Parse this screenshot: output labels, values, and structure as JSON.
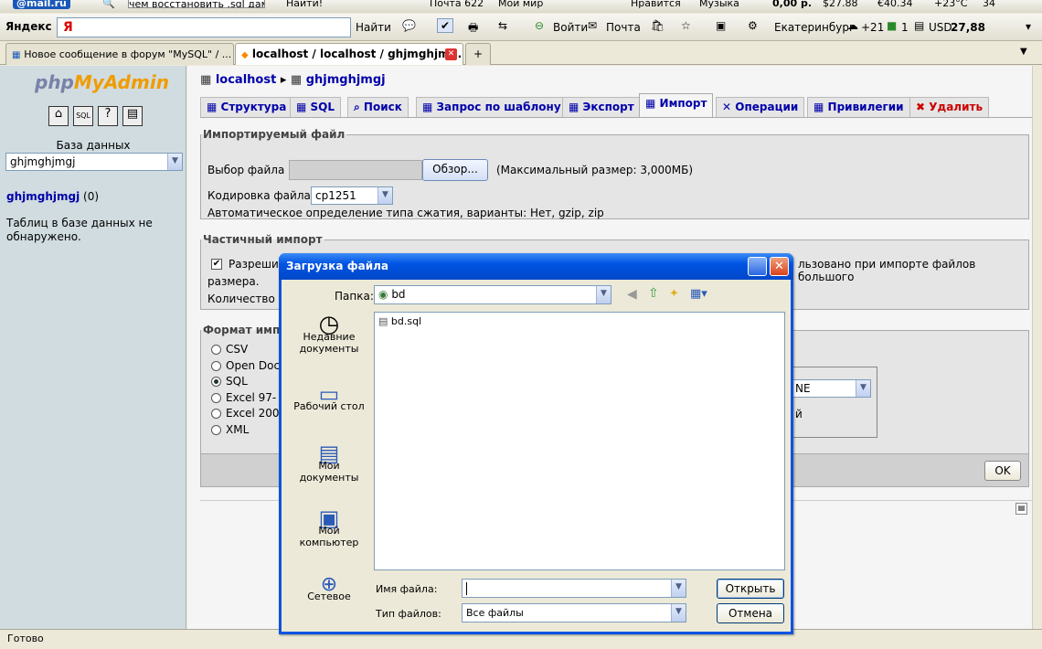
{
  "toolbar1": {
    "mail_logo": "@mail.ru",
    "search_value": "чем восстановить .sql дамп?",
    "find": "Найти!",
    "mail": "Почта 622",
    "myworld": "Мой мир",
    "likes": "Нравится",
    "music": "Музыка",
    "money": "0,00 р.",
    "usd": "$27.88",
    "eur": "€40.34",
    "weather": "+23°C",
    "num": "34"
  },
  "toolbar2": {
    "yandex": "Яндекс",
    "ya": "Я",
    "find": "Найти",
    "login": "Войти",
    "mail": "Почта",
    "city": "Екатеринбург",
    "temp": "+21",
    "one": "1",
    "usd_label": "USD",
    "usd_value": "27,88"
  },
  "tabs": [
    {
      "label": "Новое сообщение в форум \"MySQL\" / ..."
    },
    {
      "label": "localhost / localhost / ghjmghjm..."
    }
  ],
  "left": {
    "logo_php": "php",
    "logo_my": "MyAdmin",
    "db_label": "База данных",
    "db_value": "ghjmghjmgj",
    "db_link": "ghjmghjmgj",
    "db_count": "(0)",
    "no_tables": "Таблиц в базе данных не обнаружено."
  },
  "breadcrumb": {
    "server": "localhost",
    "db": "ghjmghjmgj"
  },
  "pma_tabs": [
    "Структура",
    "SQL",
    "Поиск",
    "Запрос по шаблону",
    "Экспорт",
    "Импорт",
    "Операции",
    "Привилегии",
    "Удалить"
  ],
  "import": {
    "file_legend": "Импортируемый файл",
    "file_label": "Выбор файла",
    "browse": "Обзор...",
    "max_size": "(Максимальный размер: 3,000МБ)",
    "encoding_label": "Кодировка файла:",
    "encoding_value": "cp1251",
    "compression": "Автоматическое определение типа сжатия, варианты: Нет, gzip, zip",
    "partial_legend": "Частичный импорт",
    "partial_text1": "Разреши",
    "partial_text1b": "льзовано при импорте файлов большого",
    "partial_text2": "размера.",
    "partial_text3": "Количество з",
    "format_legend": "Формат имп",
    "formats": [
      "CSV",
      "Open Doc",
      "SQL",
      "Excel 97-",
      "Excel 200",
      "XML"
    ],
    "compat_value": "NE",
    "compat_hint": "й",
    "ok": "OK"
  },
  "status": "Готово",
  "dialog": {
    "title": "Загрузка файла",
    "folder_label": "Папка:",
    "folder_value": "bd",
    "places": [
      "Недавние документы",
      "Рабочий стол",
      "Мои документы",
      "Мой компьютер",
      "Сетевое"
    ],
    "files": [
      "bd.sql"
    ],
    "filename_label": "Имя файла:",
    "filename_value": "",
    "filetype_label": "Тип файлов:",
    "filetype_value": "Все файлы",
    "open": "Открыть",
    "cancel": "Отмена"
  }
}
